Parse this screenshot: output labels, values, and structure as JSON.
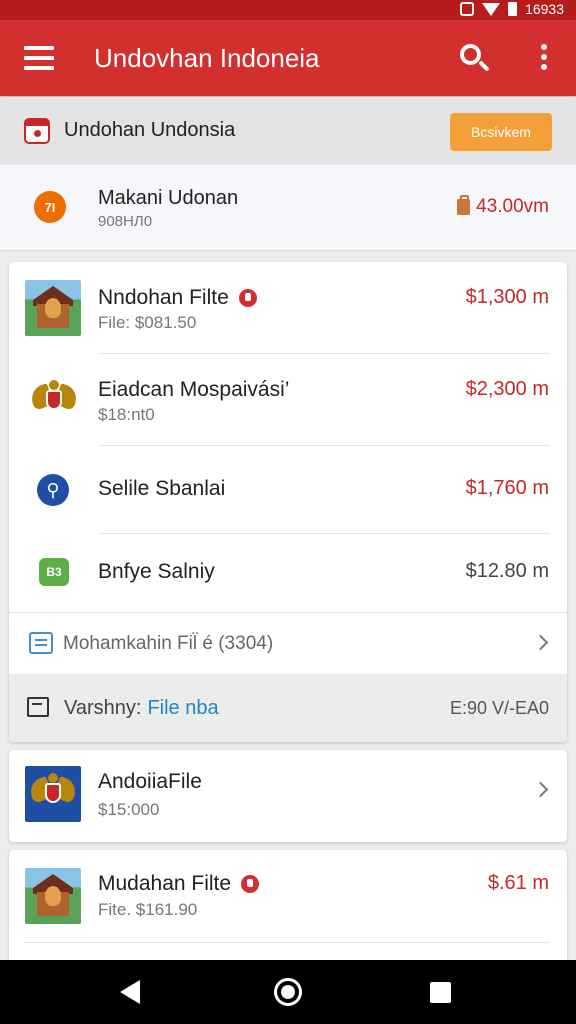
{
  "status_bar": {
    "time": "16933"
  },
  "app_bar": {
    "title": "Undovhan Indoneia",
    "icons": [
      "menu-icon",
      "search-icon",
      "more-vert-icon"
    ]
  },
  "subheader": {
    "title": "Undohan Undonsia",
    "button_label": "Bcsivkem"
  },
  "summary": {
    "title": "Makani Udonan",
    "subtitle": "908НЛ0",
    "amount": "43.00vm",
    "icon_text": "7I"
  },
  "list": [
    {
      "title": "Nndohan Filte",
      "subtitle": "File: $081.50",
      "amount": "$1,300 m",
      "icon": "temple-thumbnail"
    },
    {
      "title": "Eiadcan Mospaivási’",
      "subtitle": "$18:nt0",
      "amount": "$2,300 m",
      "icon": "garuda-emblem-icon"
    },
    {
      "title": "Selile Sbanlai",
      "amount": "$1,760 m",
      "icon": "blue-circle-icon"
    },
    {
      "title": "Bnfye Salniy",
      "amount": "$12.80 m",
      "icon": "green-app-icon"
    }
  ],
  "more_files": {
    "label": "Mohamkahin Fil̈ é (3304)"
  },
  "band": {
    "label": "Varshny:",
    "link": "File nba",
    "value": "E:90 V/-EA0"
  },
  "andoia_card": {
    "title": "AndoiiaFile",
    "subtitle": "$15:000"
  },
  "last_card": {
    "title": "Mudahan Filte",
    "subtitle": "Fite. $161.90",
    "amount": "$.61 m"
  },
  "colors": {
    "primary": "#d32f2f",
    "accent": "#f4a03a",
    "amount_red": "#c62828",
    "link_blue": "#1e88c8"
  }
}
